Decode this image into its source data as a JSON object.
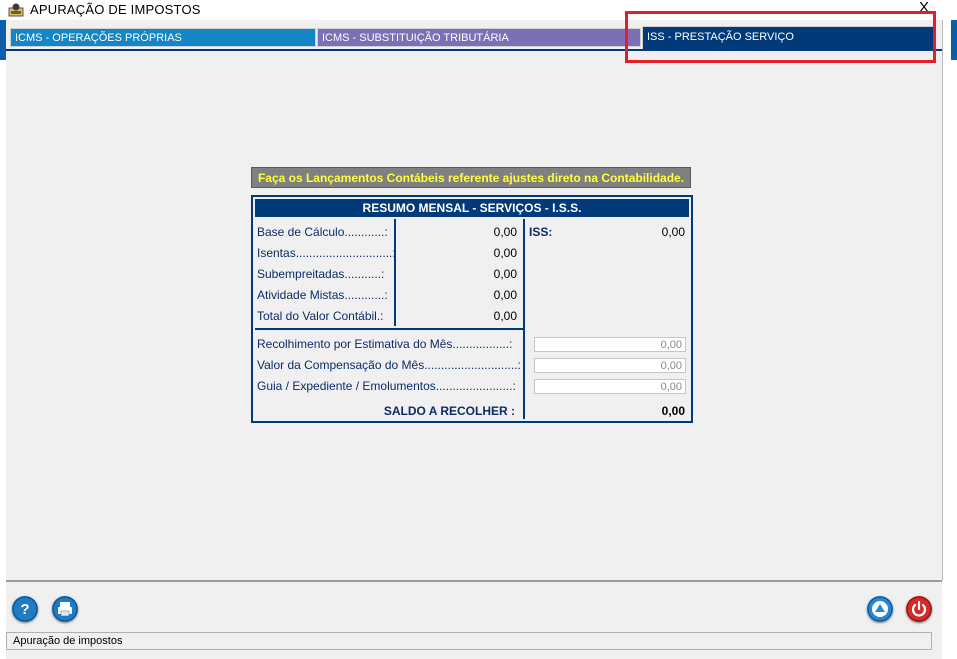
{
  "window": {
    "title": "APURAÇÃO  DE  IMPOSTOS",
    "close_label": "X"
  },
  "tabs": [
    {
      "label": "ICMS - OPERAÇÕES PRÓPRIAS",
      "color": "#1585c5"
    },
    {
      "label": "ICMS - SUBSTITUIÇÃO TRIBUTÁRIA",
      "color": "#7c6fb6"
    },
    {
      "label": "ISS - PRESTAÇÃO SERVIÇO",
      "color": "#003a78",
      "selected": true
    }
  ],
  "notice": "Faça os Lançamentos Contábeis referente ajustes direto na Contabilidade.",
  "panel": {
    "title": "RESUMO MENSAL  -  SERVIÇOS  -  I.S.S.",
    "rows": [
      {
        "label": "Base de Cálculo............:",
        "value": "0,00"
      },
      {
        "label": "Isentas.............................:",
        "value": "0,00"
      },
      {
        "label": "Subempreitadas...........:",
        "value": "0,00"
      },
      {
        "label": "Atividade Mistas............:",
        "value": "0,00"
      },
      {
        "label": "Total do Valor Contábil.:",
        "value": "0,00"
      }
    ],
    "iss_label": "ISS:",
    "iss_value": "0,00",
    "inputs": [
      {
        "label": "Recolhimento por Estimativa do Mês.................:",
        "value": "0,00"
      },
      {
        "label": "Valor da Compensação do Mês............................:",
        "value": "0,00"
      },
      {
        "label": "Guia / Expediente / Emolumentos.......................:",
        "value": "0,00"
      }
    ],
    "saldo_label": "SALDO A RECOLHER :",
    "saldo_value": "0,00"
  },
  "footer": {
    "icons": [
      "help-icon",
      "print-icon",
      "up-arrow-icon",
      "power-icon"
    ],
    "status_text": "Apuração de impostos"
  },
  "colors": {
    "accent": "#003a78",
    "highlight": "#e41e26",
    "notice_text": "#ffff3a"
  }
}
